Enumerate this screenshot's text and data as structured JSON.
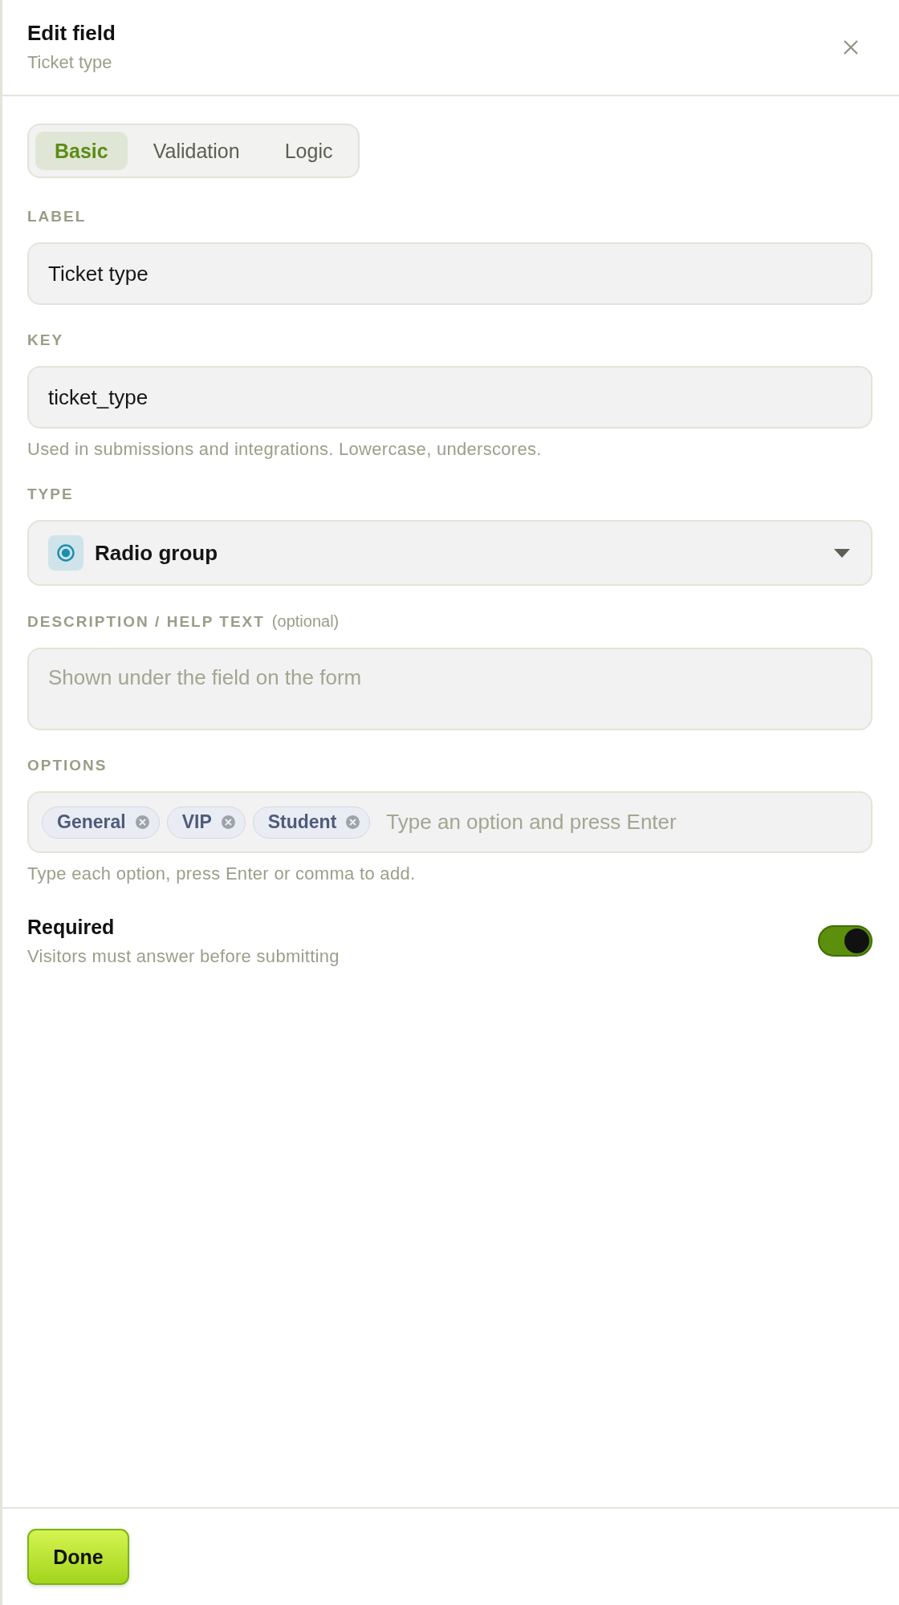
{
  "header": {
    "title": "Edit field",
    "subtitle": "Ticket type"
  },
  "tabs": [
    {
      "label": "Basic",
      "selected": true
    },
    {
      "label": "Validation",
      "selected": false
    },
    {
      "label": "Logic",
      "selected": false
    }
  ],
  "fields": [
    {
      "kind": "text",
      "label": "LABEL",
      "value": "Ticket type"
    },
    {
      "kind": "text",
      "label": "KEY",
      "value": "ticket_type",
      "help": "Used in submissions and integrations. Lowercase, underscores."
    },
    {
      "kind": "select",
      "label": "TYPE",
      "value": "Radio group"
    },
    {
      "kind": "textarea",
      "label": "DESCRIPTION / HELP TEXT",
      "note": "(optional)",
      "placeholder": "Shown under the field on the form"
    },
    {
      "kind": "tags",
      "label": "OPTIONS",
      "tags": [
        "General",
        "VIP",
        "Student"
      ],
      "placeholder": "Type an option and press Enter",
      "help": "Type each option, press Enter or comma to add."
    }
  ],
  "required": {
    "title": "Required",
    "description": "Visitors must answer before submitting",
    "on": true
  },
  "footer": {
    "button": "Done"
  }
}
